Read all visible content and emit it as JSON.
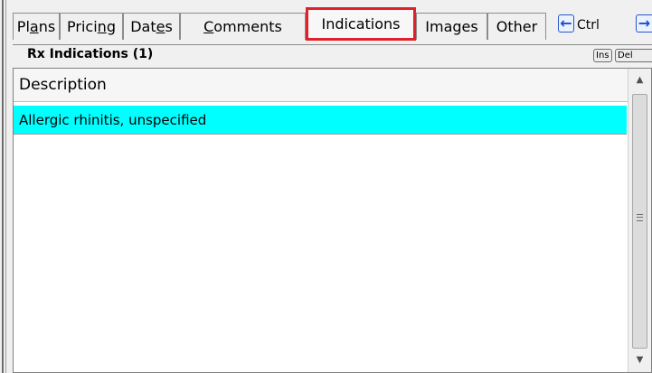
{
  "tabs": [
    {
      "label": "Plans"
    },
    {
      "label": "Pricing"
    },
    {
      "label": "Dates"
    },
    {
      "label": "Comments"
    },
    {
      "label": "Indications",
      "active": true
    },
    {
      "label": "Images"
    },
    {
      "label": "Other"
    }
  ],
  "nav": {
    "ctrl_label": "Ctrl",
    "prev_icon": "arrow-left-icon",
    "next_icon": "arrow-right-icon"
  },
  "panel": {
    "title": "Rx Indications (1)",
    "ins_label": "Ins",
    "del_label": "Del"
  },
  "table": {
    "columns": [
      "Description"
    ],
    "rows": [
      {
        "description": "Allergic rhinitis, unspecified",
        "selected": true
      }
    ]
  },
  "colors": {
    "selected_row": "#00ffff",
    "active_tab_highlight": "#e0202a",
    "arrow_blue": "#1a4bd6"
  }
}
